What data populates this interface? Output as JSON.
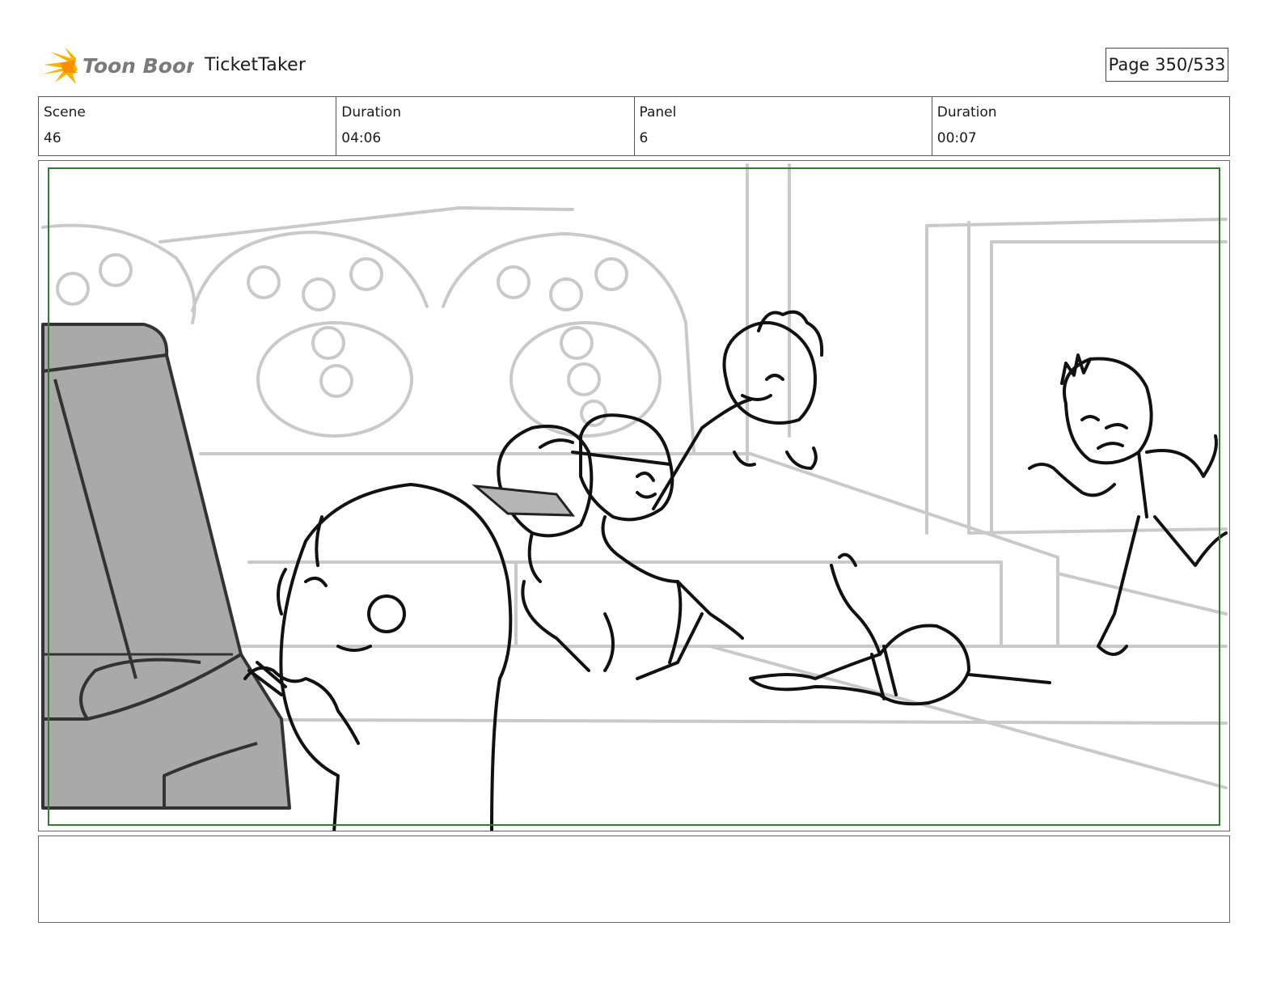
{
  "header": {
    "logo_text": "Toon Boom",
    "project_title": "TicketTaker",
    "page_label": "Page 350/533"
  },
  "info": [
    {
      "label": "Scene",
      "value": "46"
    },
    {
      "label": "Duration",
      "value": "04:06"
    },
    {
      "label": "Panel",
      "value": "6"
    },
    {
      "label": "Duration",
      "value": "00:07"
    }
  ],
  "panel": {
    "frame_color": "#2e7d32",
    "sketch_color": "#111111",
    "background_sketch_color": "#c9c9c9",
    "seat_fill_color": "#a9a9a9"
  },
  "notes": {
    "text": ""
  }
}
